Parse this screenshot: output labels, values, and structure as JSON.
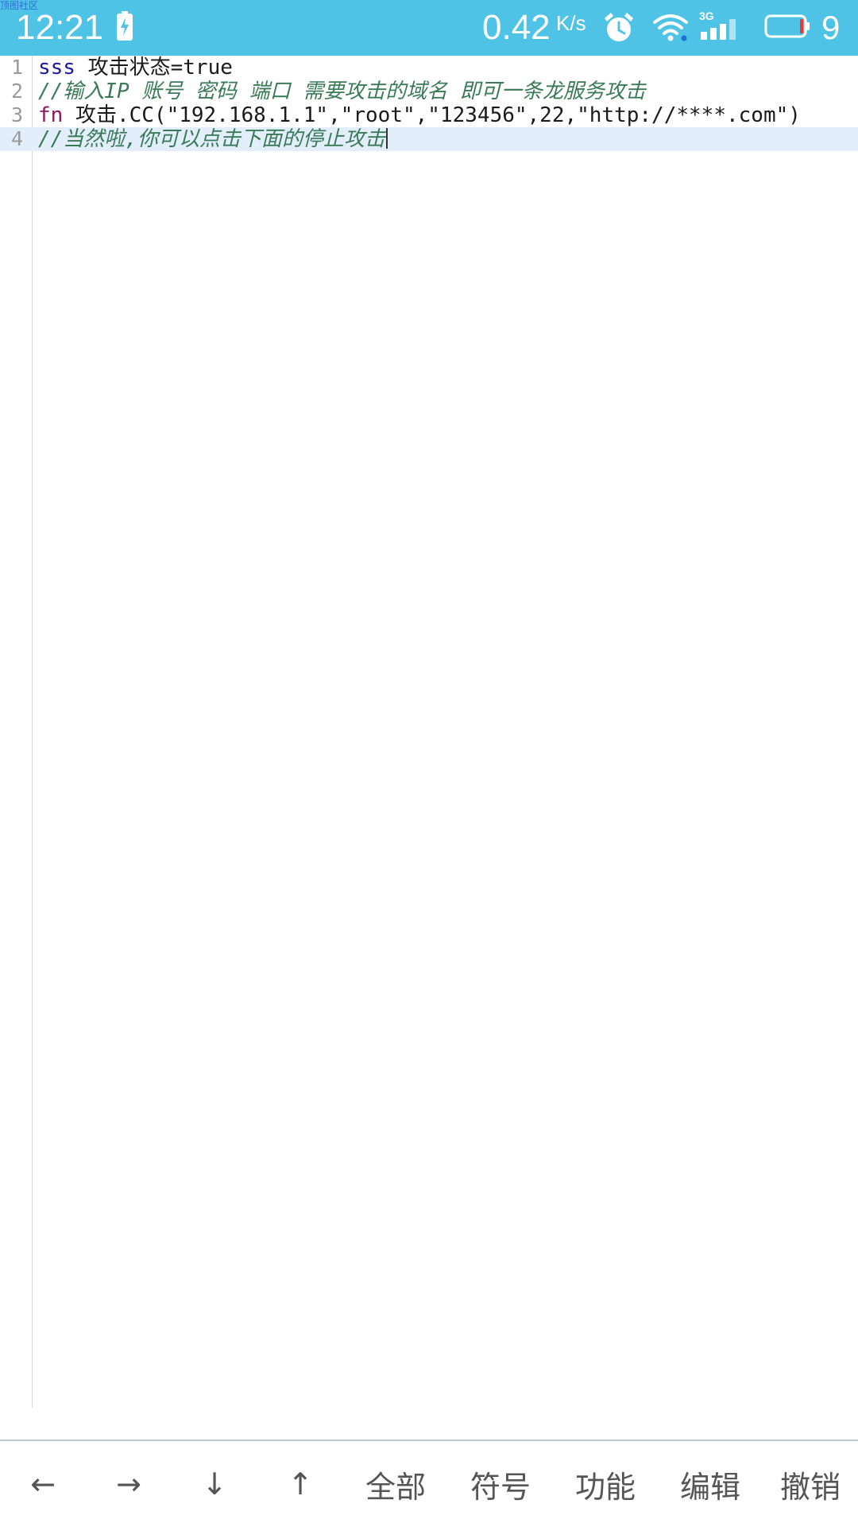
{
  "status_bar": {
    "watermark": "顶图社区",
    "time": "12:21",
    "net_speed": "0.42",
    "net_speed_unit": "K/s",
    "network_type": "3G",
    "battery_level": "9",
    "colors": {
      "background": "#4fc3e6",
      "battery_low": "#e53935"
    },
    "icons": [
      "charging-icon",
      "alarm-icon",
      "wifi-icon",
      "signal-icon",
      "battery-icon"
    ]
  },
  "editor": {
    "current_line": 4,
    "lines": [
      {
        "number": "1",
        "parts": [
          "sss",
          " 攻击状态=true"
        ]
      },
      {
        "number": "2",
        "parts": [
          "//输入IP 账号 密码 端口 需要攻击的域名 即可一条龙服务攻击"
        ]
      },
      {
        "number": "3",
        "parts": [
          "fn",
          " 攻击.CC(\"192.168.1.1\",\"root\",\"123456\",22,\"http://****.com\")"
        ]
      },
      {
        "number": "4",
        "parts": [
          "//当然啦,你可以点击下面的停止攻击"
        ]
      }
    ]
  },
  "toolbar": {
    "buttons": [
      {
        "label": "←",
        "name": "arrow-left-button"
      },
      {
        "label": "→",
        "name": "arrow-right-button"
      },
      {
        "label": "↓",
        "name": "arrow-down-button"
      },
      {
        "label": "↑",
        "name": "arrow-up-button"
      },
      {
        "label": "全部",
        "name": "select-all-button"
      },
      {
        "label": "符号",
        "name": "symbols-button"
      },
      {
        "label": "功能",
        "name": "functions-button"
      },
      {
        "label": "编辑",
        "name": "edit-button"
      },
      {
        "label": "撤销",
        "name": "undo-button"
      }
    ]
  }
}
